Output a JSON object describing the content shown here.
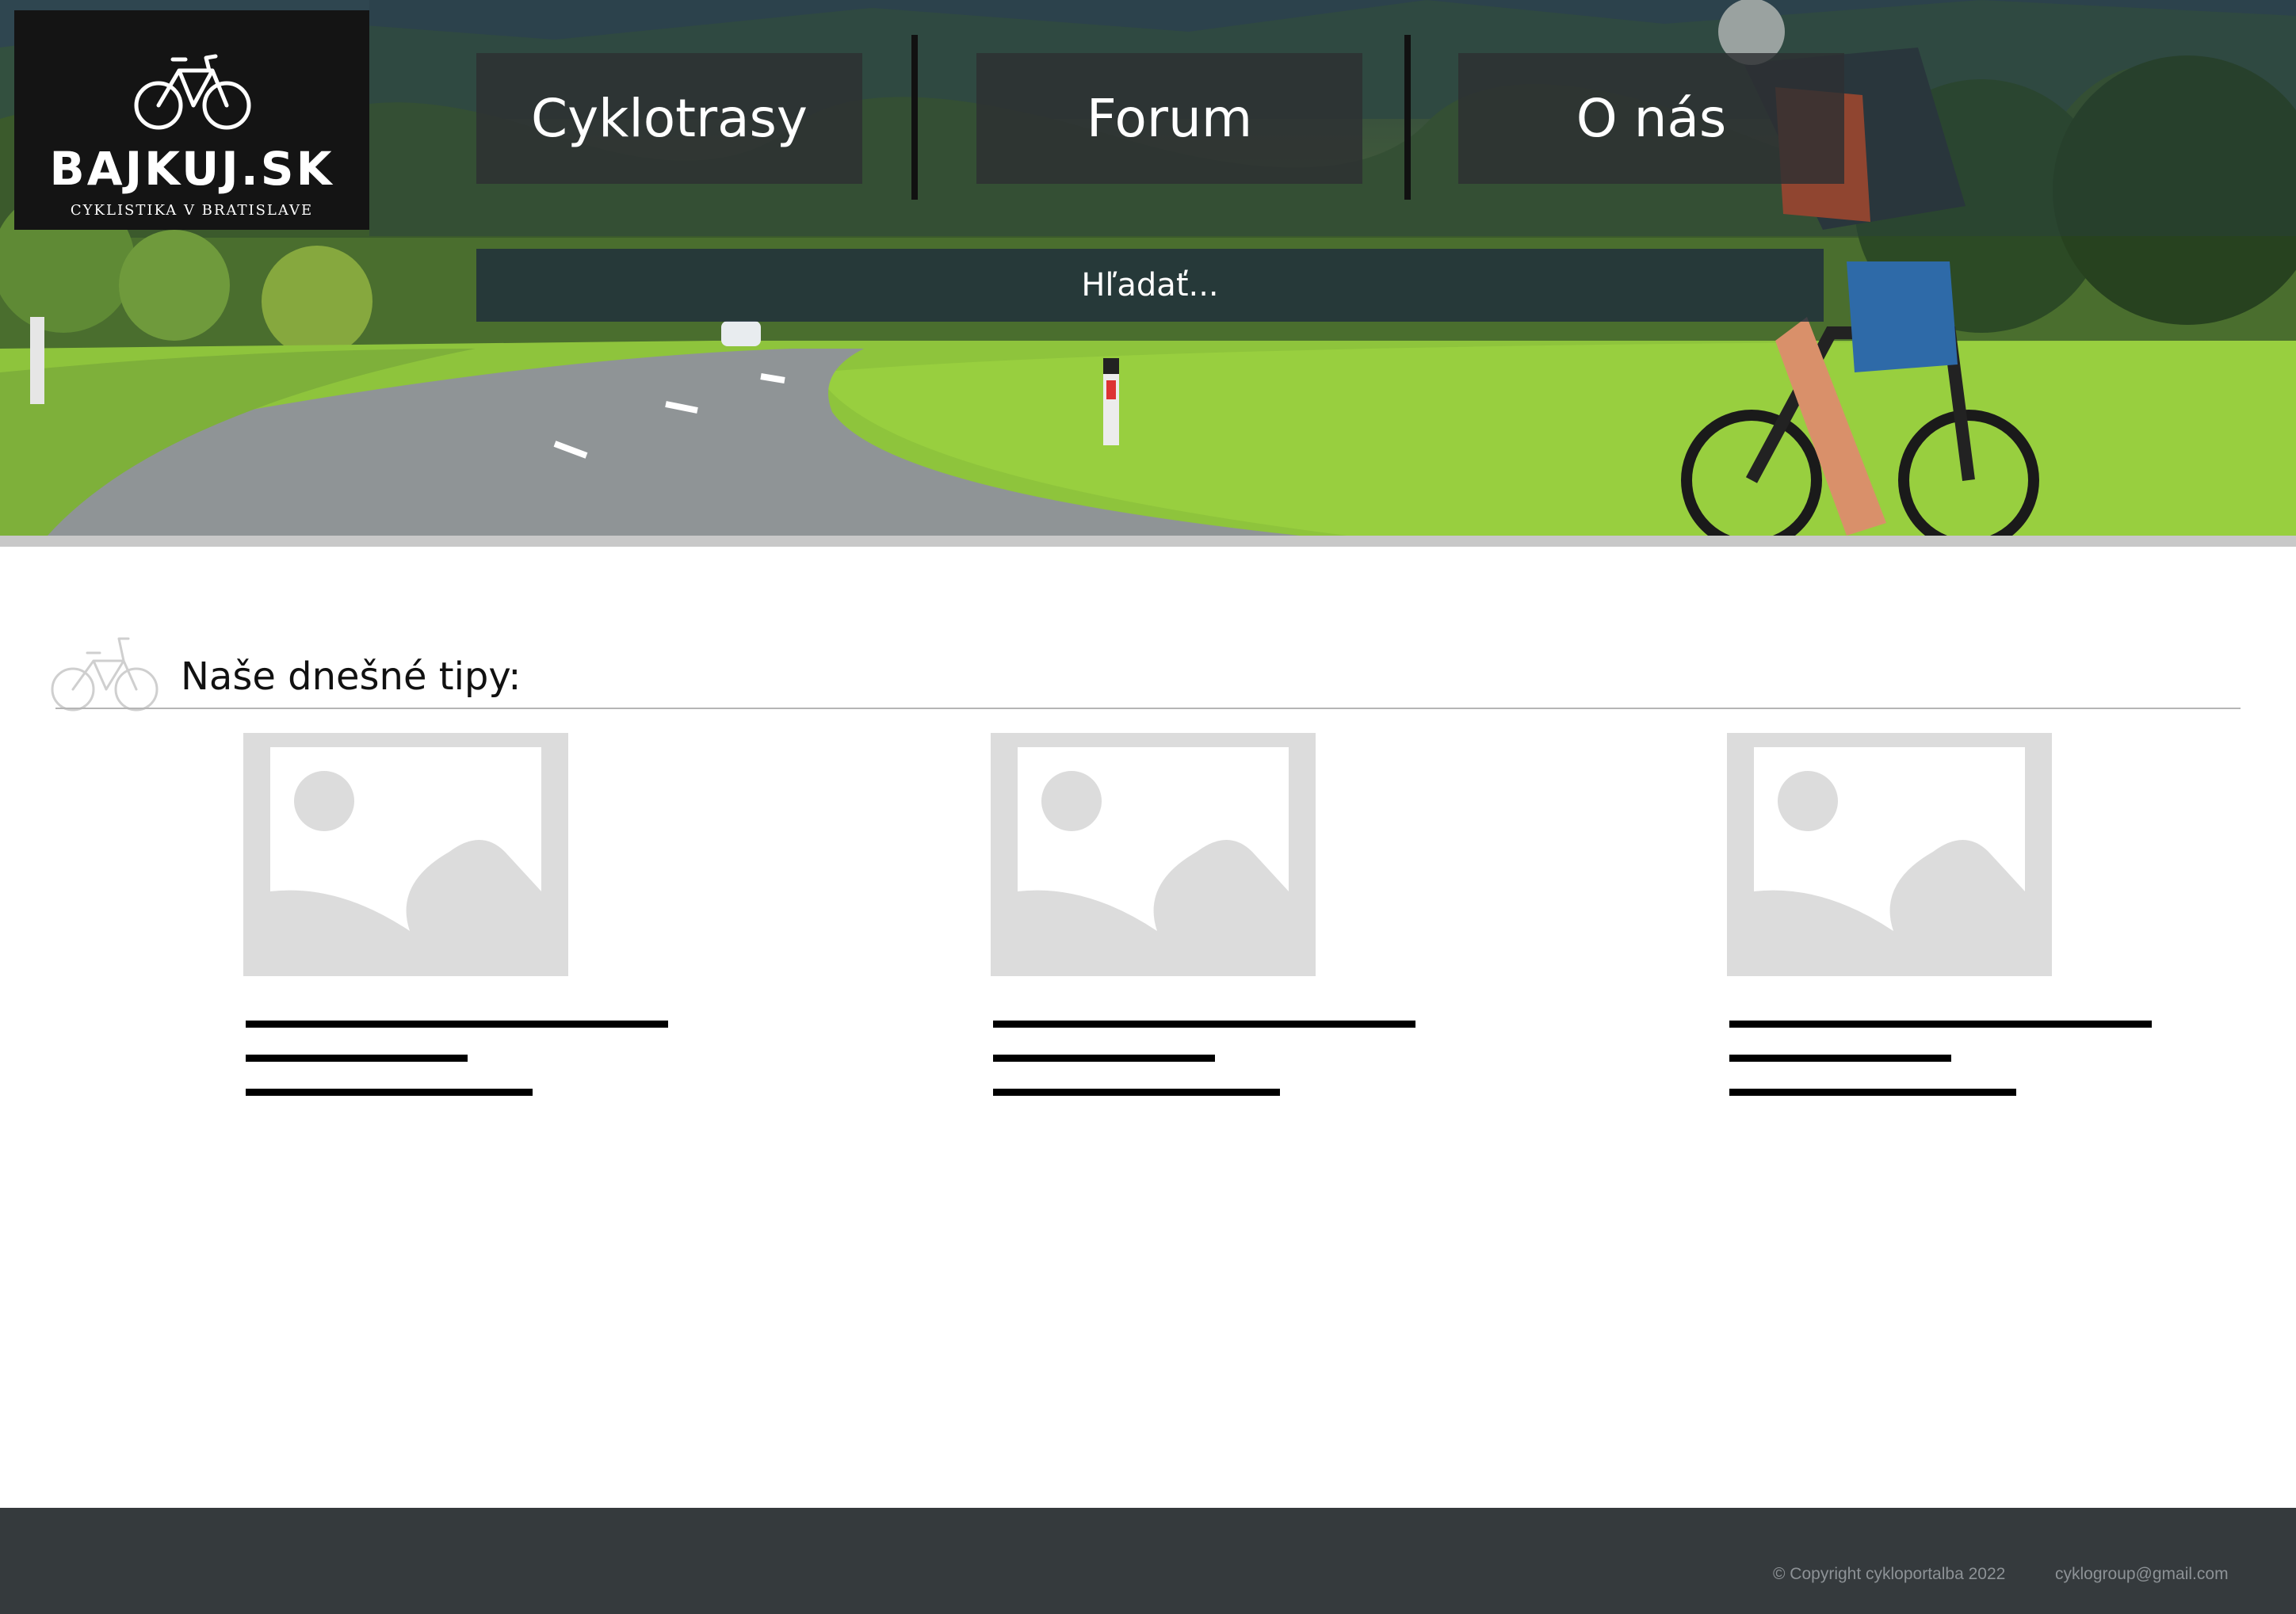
{
  "header": {
    "logo": {
      "name": "BAJKUJ.SK",
      "tagline": "CYKLISTIKA V BRATISLAVE"
    },
    "nav": [
      {
        "label": "Cyklotrasy"
      },
      {
        "label": "Forum"
      },
      {
        "label": "O nás"
      }
    ],
    "search": {
      "placeholder": "Hľadať..."
    }
  },
  "tips": {
    "title": "Naše dnešné tipy:",
    "cards": [
      {
        "image_icon": "image-placeholder-icon"
      },
      {
        "image_icon": "image-placeholder-icon"
      },
      {
        "image_icon": "image-placeholder-icon"
      }
    ]
  },
  "footer": {
    "copyright": "© Copyright cykloportalba 2022",
    "email": "cyklogroup@gmail.com"
  },
  "colors": {
    "footer_bg": "#353a3d",
    "logo_bg": "#141414",
    "placeholder_gray": "#dcdcdc"
  }
}
